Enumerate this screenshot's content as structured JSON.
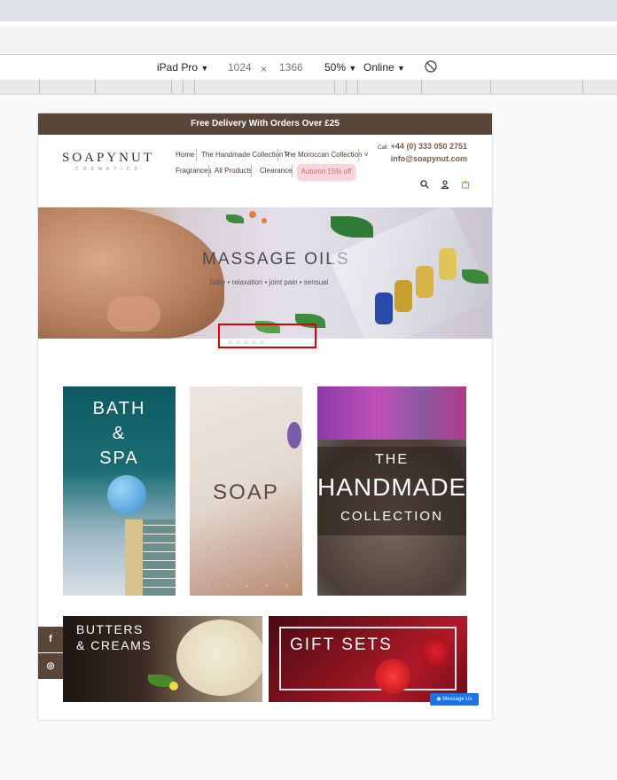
{
  "devtools": {
    "device": "iPad Pro",
    "width": "1024",
    "times": "×",
    "height": "1366",
    "zoom": "50%",
    "network": "Online",
    "dropdown_glyph": "▼"
  },
  "site": {
    "promo": "Free Delivery With Orders Over £25",
    "logo": "SOAPYNUT",
    "logo_sub": "COSMETICS",
    "nav": {
      "home": "Home",
      "handmade": "The Handmade Collection ˅",
      "moroccan": "The Moroccan Collection ˅",
      "fragrances": "Fragrances",
      "all_products": "All Products",
      "clearance": "Clearance",
      "sale": "Autumn 15% off"
    },
    "contact": {
      "call_label": "Call:",
      "phone": "+44 (0) 333 050 2751",
      "email": "info@soapynut.com"
    },
    "hero": {
      "title": "MASSAGE OILS",
      "subtitle": "baby • relaxation • joint pain • sensual"
    },
    "tiles": {
      "bath_line1": "BATH",
      "bath_line2": "&",
      "bath_line3": "SPA",
      "soap": "SOAP",
      "handmade_line1": "THE",
      "handmade_line2": "HANDMADE",
      "handmade_line3": "COLLECTION",
      "butters_line1": "BUTTERS",
      "butters_line2": "& CREAMS",
      "gift": "GIFT SETS"
    },
    "social": {
      "facebook": "f",
      "instagram": "◎"
    },
    "messenger": "Message Us"
  },
  "colors": {
    "brand_brown": "#5a4638",
    "sale_pink": "#f9d5d9",
    "highlight": "#e00000",
    "messenger_blue": "#1a73e8"
  }
}
